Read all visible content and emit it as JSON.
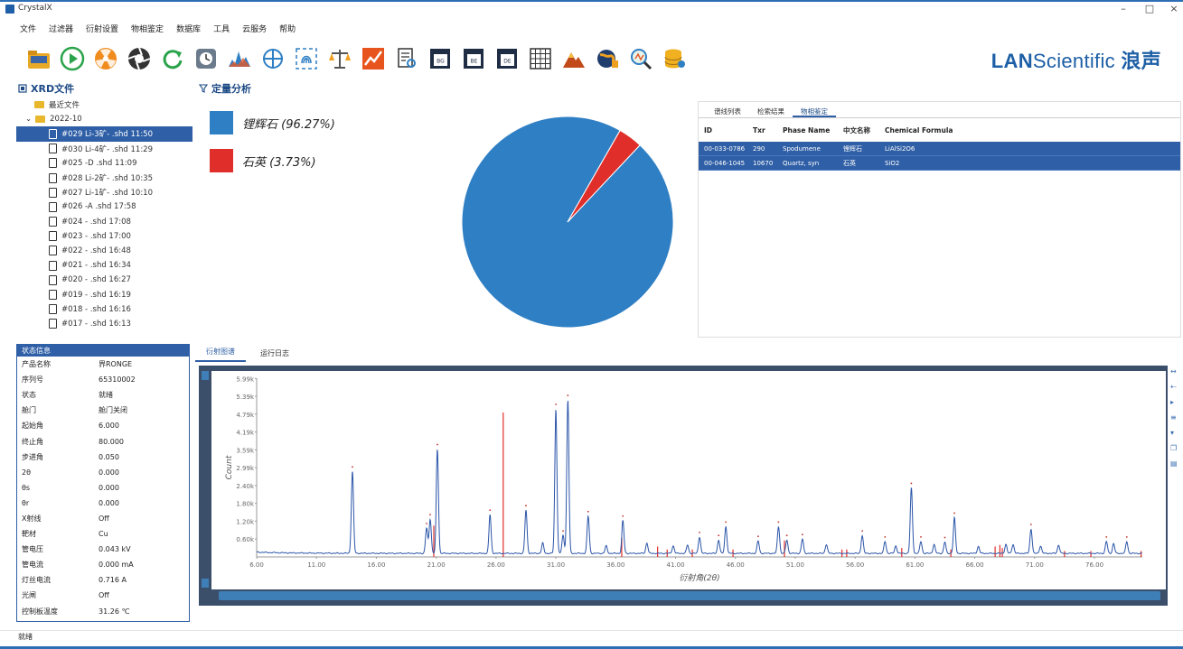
{
  "window": {
    "title": "CrystalX",
    "min": "–",
    "max": "□",
    "close": "×"
  },
  "menu": [
    "文件",
    "过滤器",
    "衍射设置",
    "物相鉴定",
    "数据库",
    "工具",
    "云服务",
    "帮助"
  ],
  "brand": {
    "bold": "LAN",
    "rest": "Scientific",
    "cn": "浪声"
  },
  "toolbar_icons": [
    "folder-icon",
    "play-icon",
    "radiation-icon",
    "aperture-icon",
    "refresh-icon",
    "clock-icon",
    "peak-chart-icon",
    "crosshair-icon",
    "fingerprint-icon",
    "balance-icon",
    "trend-chart-icon",
    "document-search-icon",
    "bg-icon",
    "be-icon",
    "de-icon",
    "grid-icon",
    "mountain-icon",
    "globe-icon",
    "magnify-icon",
    "database-icon"
  ],
  "tree": {
    "title": "XRD文件",
    "recent": "最近文件",
    "folder": "2022-10",
    "files": [
      "#029 Li-3矿- .shd 11:50",
      "#030 Li-4矿- .shd 11:29",
      "#025 -D .shd 11:09",
      "#028 Li-2矿- .shd 10:35",
      "#027 Li-1矿- .shd 10:10",
      "#026 -A .shd 17:58",
      "#024 - .shd 17:08",
      "#023 - .shd 17:00",
      "#022 - .shd 16:48",
      "#021 - .shd 16:34",
      "#020 - .shd 16:27",
      "#019 - .shd 16:19",
      "#018 - .shd 16:16",
      "#017 - .shd 16:13"
    ]
  },
  "status": {
    "title": "状态信息",
    "rows": [
      {
        "k": "产品名称",
        "v": "界RONGE"
      },
      {
        "k": "序列号",
        "v": "65310002"
      },
      {
        "k": "状态",
        "v": "就绪"
      },
      {
        "k": "舱门",
        "v": "舱门关闭"
      },
      {
        "k": "起始角",
        "v": "6.000"
      },
      {
        "k": "终止角",
        "v": "80.000"
      },
      {
        "k": "步进角",
        "v": "0.050"
      },
      {
        "k": "2θ",
        "v": "0.000"
      },
      {
        "k": "θs",
        "v": "0.000"
      },
      {
        "k": "θr",
        "v": "0.000"
      },
      {
        "k": "X射线",
        "v": "Off"
      },
      {
        "k": "靶材",
        "v": "Cu"
      },
      {
        "k": "管电压",
        "v": "0.043 kV"
      },
      {
        "k": "管电流",
        "v": "0.000 mA"
      },
      {
        "k": "灯丝电流",
        "v": "0.716 A"
      },
      {
        "k": "光闸",
        "v": "Off"
      },
      {
        "k": "控制板温度",
        "v": "31.26 ℃"
      }
    ]
  },
  "quant": {
    "title": "定量分析",
    "items": [
      {
        "label": "锂辉石 (96.27%)",
        "color": "#2f7fc4"
      },
      {
        "label": "石英 (3.73%)",
        "color": "#e02e2a"
      }
    ]
  },
  "chart_data": [
    {
      "type": "pie",
      "labels": [
        "锂辉石",
        "石英"
      ],
      "values": [
        96.27,
        3.73
      ],
      "colors": [
        "#2f7fc4",
        "#e02e2a"
      ]
    },
    {
      "type": "line",
      "xlabel": "衍射角(2θ)",
      "ylabel": "Count",
      "x_ticks": [
        "6.00",
        "11.00",
        "16.00",
        "21.00",
        "26.00",
        "31.00",
        "36.00",
        "41.00",
        "46.00",
        "51.00",
        "56.00",
        "61.00",
        "66.00",
        "71.00",
        "76.00"
      ],
      "y_ticks": [
        "0.60k",
        "1.20k",
        "1.80k",
        "2.40k",
        "2.99k",
        "3.59k",
        "4.19k",
        "4.79k",
        "5.39k",
        "5.99k"
      ],
      "xlim": [
        6,
        80
      ],
      "ylim": [
        0,
        6000
      ],
      "series": [
        {
          "color": "#2b55a8",
          "baseline": 120,
          "peaks": [
            [
              14.0,
              2750
            ],
            [
              20.2,
              850
            ],
            [
              20.5,
              1150
            ],
            [
              21.1,
              3500
            ],
            [
              25.5,
              1300
            ],
            [
              28.5,
              1450
            ],
            [
              29.9,
              350
            ],
            [
              31.0,
              4850
            ],
            [
              31.6,
              600
            ],
            [
              32.0,
              5150
            ],
            [
              33.7,
              1250
            ],
            [
              35.2,
              250
            ],
            [
              36.6,
              1100
            ],
            [
              38.6,
              350
            ],
            [
              40.8,
              250
            ],
            [
              42.0,
              280
            ],
            [
              43.0,
              550
            ],
            [
              44.6,
              450
            ],
            [
              45.2,
              900
            ],
            [
              47.9,
              420
            ],
            [
              49.6,
              900
            ],
            [
              50.3,
              450
            ],
            [
              51.6,
              480
            ],
            [
              53.6,
              300
            ],
            [
              56.6,
              600
            ],
            [
              58.5,
              400
            ],
            [
              59.4,
              250
            ],
            [
              60.7,
              2200
            ],
            [
              61.5,
              400
            ],
            [
              62.6,
              300
            ],
            [
              63.5,
              380
            ],
            [
              64.3,
              1200
            ],
            [
              66.3,
              230
            ],
            [
              68.6,
              300
            ],
            [
              69.2,
              300
            ],
            [
              70.7,
              820
            ],
            [
              71.5,
              250
            ],
            [
              73.0,
              280
            ],
            [
              77.0,
              400
            ],
            [
              77.6,
              330
            ],
            [
              78.7,
              400
            ]
          ]
        },
        {
          "color": "#e02e2a",
          "sticks": [
            [
              26.6,
              4850
            ],
            [
              20.8,
              1050
            ],
            [
              36.5,
              650
            ],
            [
              39.5,
              350
            ],
            [
              40.3,
              250
            ],
            [
              42.4,
              250
            ],
            [
              45.8,
              250
            ],
            [
              50.1,
              550
            ],
            [
              54.9,
              250
            ],
            [
              55.3,
              250
            ],
            [
              59.9,
              300
            ],
            [
              64.0,
              250
            ],
            [
              67.7,
              350
            ],
            [
              68.1,
              400
            ],
            [
              68.3,
              300
            ],
            [
              73.5,
              200
            ],
            [
              75.7,
              200
            ],
            [
              79.9,
              200
            ]
          ]
        }
      ]
    }
  ],
  "phase_table": {
    "tabs": [
      "谱线列表",
      "检索结果",
      "物相鉴定"
    ],
    "headers": [
      "ID",
      "Txr",
      "Phase Name",
      "中文名称",
      "Chemical Formula"
    ],
    "rows": [
      [
        "00-033-0786",
        "290",
        "Spodumene",
        "锂辉石",
        "LiAlSi2O6"
      ],
      [
        "00-046-1045",
        "10670",
        "Quartz, syn",
        "石英",
        "SiO2"
      ]
    ]
  },
  "diff_tabs": [
    "衍射图谱",
    "运行日志"
  ],
  "statusbar": "就绪"
}
